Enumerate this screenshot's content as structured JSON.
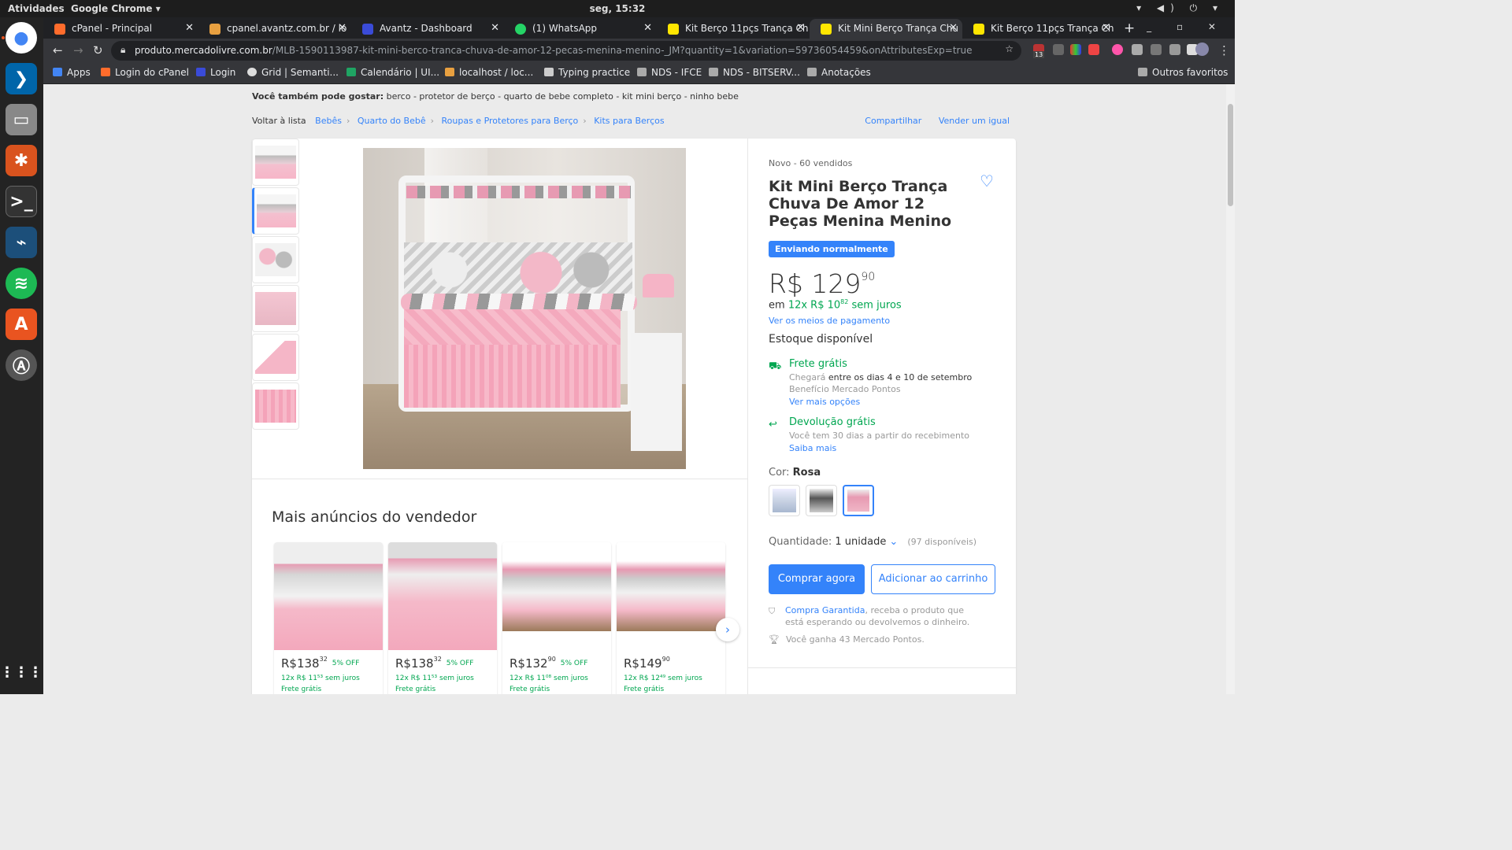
{
  "os": {
    "activities": "Atividades",
    "app": "Google Chrome ▾",
    "clock": "seg, 15:32",
    "tray": "▾ ◀) ⏻ ▾"
  },
  "browser": {
    "tabs": [
      {
        "label": "cPanel - Principal",
        "color": "#ff6c2c"
      },
      {
        "label": "cpanel.avantz.com.br / lo",
        "color": "#e8a040"
      },
      {
        "label": "Avantz - Dashboard",
        "color": "#3a4bd8"
      },
      {
        "label": "(1) WhatsApp",
        "color": "#25d366"
      },
      {
        "label": "Kit Berço 11pçs Trança Ch",
        "color": "#ffe600"
      },
      {
        "label": "Kit Mini Berço Trança Chu",
        "color": "#ffe600"
      },
      {
        "label": "Kit Berço 11pçs Trança Ch",
        "color": "#ffe600"
      }
    ],
    "new_tab": "+",
    "url_domain": "produto.mercadolivre.com.br",
    "url_path": "/MLB-1590113987-kit-mini-berco-tranca-chuva-de-amor-12-pecas-menina-menino-_JM?quantity=1&variation=59736054459&onAttributesExp=true",
    "ext_badge": "13",
    "bookmarks": [
      {
        "label": "Apps",
        "color": "#4285f4"
      },
      {
        "label": "Login do cPanel",
        "color": "#ff6c2c"
      },
      {
        "label": "Login",
        "color": "#3a4bd8"
      },
      {
        "label": "Grid | Semanti...",
        "color": "#dddddd"
      },
      {
        "label": "Calendário | UI...",
        "color": "#1fa463"
      },
      {
        "label": "localhost / loc...",
        "color": "#e8a040"
      },
      {
        "label": "Typing practice",
        "color": "#cccccc"
      },
      {
        "label": "NDS - IFCE",
        "color": "#aaaaaa"
      },
      {
        "label": "NDS - BITSERV...",
        "color": "#aaaaaa"
      },
      {
        "label": "Anotações",
        "color": "#aaaaaa"
      }
    ],
    "other_bookmarks": "Outros favoritos"
  },
  "page": {
    "also_label": "Você também pode gostar:",
    "also_items": "berco - protetor de berço - quarto de bebe completo - kit mini berço - ninho bebe",
    "back": "Voltar à lista",
    "breadcrumb": [
      "Bebês",
      "Quarto do Bebê",
      "Roupas e Protetores para Berço",
      "Kits para Berços"
    ],
    "share": "Compartilhar",
    "sell_same": "Vender um igual",
    "more_title": "Mais anúncios do vendedor",
    "more_items": [
      {
        "price": "R$138",
        "cents": "32",
        "off": "5% OFF",
        "inst": "12x R$ 11⁵³ sem juros",
        "ship": "Frete grátis"
      },
      {
        "price": "R$138",
        "cents": "32",
        "off": "5% OFF",
        "inst": "12x R$ 11⁵³ sem juros",
        "ship": "Frete grátis"
      },
      {
        "price": "R$132",
        "cents": "90",
        "off": "5% OFF",
        "inst": "12x R$ 11⁰⁸ sem juros",
        "ship": "Frete grátis"
      },
      {
        "price": "R$149",
        "cents": "90",
        "off": "",
        "inst": "12x R$ 12⁴⁹ sem juros",
        "ship": "Frete grátis"
      }
    ],
    "next_arrow": "›"
  },
  "product": {
    "meta": "Novo  -  60 vendidos",
    "title": "Kit Mini Berço Trança Chuva De Amor 12 Peças Menina Menino",
    "badge": "Enviando normalmente",
    "price": "R$ 129",
    "price_cents": "90",
    "inst_prefix": "em",
    "inst_value": "12x R$ 10",
    "inst_cents": "82",
    "inst_suffix": "sem juros",
    "payment_link": "Ver os meios de pagamento",
    "stock": "Estoque disponível",
    "shipping_title": "Frete grátis",
    "shipping_arrives_label": "Chegará",
    "shipping_arrives": "entre os dias 4 e 10 de setembro",
    "shipping_benefit": "Benefício Mercado Pontos",
    "shipping_more": "Ver mais opções",
    "return_title": "Devolução grátis",
    "return_text": "Você tem 30 dias a partir do recebimento",
    "return_more": "Saiba mais",
    "color_label": "Cor:",
    "color_value": "Rosa",
    "qty_label": "Quantidade:",
    "qty_value": "1 unidade",
    "qty_available": "(97 disponíveis)",
    "buy_now": "Comprar agora",
    "add_cart": "Adicionar ao carrinho",
    "guarantee_link": "Compra Garantida",
    "guarantee_text": ", receba o produto que está esperando ou devolvemos o dinheiro.",
    "points": "Você ganha 43 Mercado Pontos."
  },
  "colors": {
    "accent": "#3483fa",
    "success": "#00a650"
  }
}
